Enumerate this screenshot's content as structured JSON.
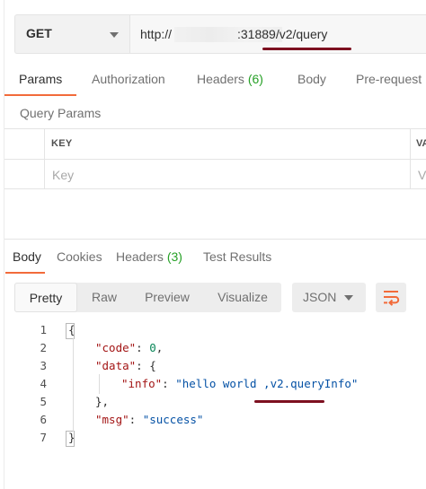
{
  "request": {
    "method": "GET",
    "url_prefix": "http://",
    "url_suffix": ":31889/v2/query"
  },
  "request_tabs": [
    {
      "label": "Params",
      "active": true
    },
    {
      "label": "Authorization"
    },
    {
      "label": "Headers",
      "count": "(6)"
    },
    {
      "label": "Body"
    },
    {
      "label": "Pre-request"
    }
  ],
  "params": {
    "section_title": "Query Params",
    "columns": [
      "KEY",
      "VA"
    ],
    "placeholders": [
      "Key",
      "V"
    ]
  },
  "response_tabs": [
    {
      "label": "Body",
      "active": true
    },
    {
      "label": "Cookies"
    },
    {
      "label": "Headers",
      "count": "(3)"
    },
    {
      "label": "Test Results"
    }
  ],
  "view_modes": [
    "Pretty",
    "Raw",
    "Preview",
    "Visualize"
  ],
  "active_view": "Pretty",
  "format": "JSON",
  "icons": [
    "chevron-down-icon",
    "wrap-lines-icon"
  ],
  "colors": {
    "accent": "#f26b3a",
    "count": "#26a026",
    "annotation": "#7d1020",
    "json_key": "#a31515",
    "json_string": "#0451a5",
    "json_number": "#098658"
  },
  "code_lines": [
    {
      "n": "1",
      "text": "{"
    },
    {
      "n": "2",
      "key": "\"code\"",
      "sep": ": ",
      "val": "0",
      "tail": ","
    },
    {
      "n": "3",
      "key": "\"data\"",
      "sep": ": ",
      "tail": "{"
    },
    {
      "n": "4",
      "key": "\"info\"",
      "sep": ": ",
      "val": "\"hello world ,v2.queryInfo\""
    },
    {
      "n": "5",
      "text": "},"
    },
    {
      "n": "6",
      "key": "\"msg\"",
      "sep": ": ",
      "val": "\"success\""
    },
    {
      "n": "7",
      "text": "}"
    }
  ]
}
